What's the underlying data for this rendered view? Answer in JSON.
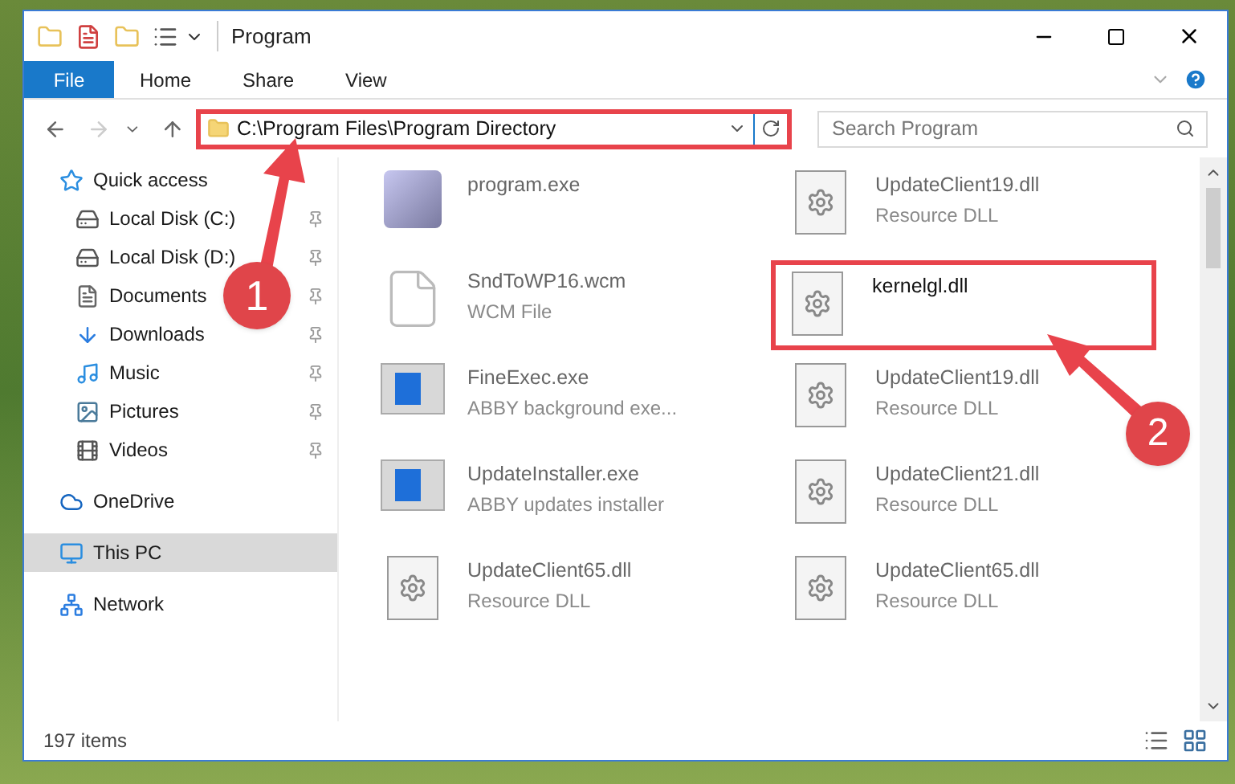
{
  "window": {
    "title": "Program"
  },
  "ribbon_tabs": [
    {
      "label": "File",
      "selected": true
    },
    {
      "label": "Home",
      "selected": false
    },
    {
      "label": "Share",
      "selected": false
    },
    {
      "label": "View",
      "selected": false
    }
  ],
  "address_bar": {
    "path": "C:\\Program Files\\Program Directory",
    "highlighted": true
  },
  "search": {
    "placeholder": "Search Program"
  },
  "sidebar": {
    "items": [
      {
        "label": "Quick access",
        "selected": false,
        "children": [
          {
            "label": "Local Disk (C:)",
            "pinned": true
          },
          {
            "label": "Local Disk (D:)",
            "pinned": true
          },
          {
            "label": "Documents",
            "pinned": true
          },
          {
            "label": "Downloads",
            "pinned": true
          },
          {
            "label": "Music",
            "pinned": true
          },
          {
            "label": "Pictures",
            "pinned": true
          },
          {
            "label": "Videos",
            "pinned": true
          }
        ]
      },
      {
        "label": "OneDrive",
        "selected": false
      },
      {
        "label": "This PC",
        "selected": true
      },
      {
        "label": "Network",
        "selected": false
      }
    ]
  },
  "files": [
    {
      "name": "program.exe",
      "kind": "exe",
      "highlighted": false
    },
    {
      "name": "UpdateClient19.dll",
      "type": "Resource DLL",
      "kind": "dll",
      "highlighted": false
    },
    {
      "name": "SndToWP16.wcm",
      "type": "WCM File",
      "kind": "blank",
      "highlighted": false
    },
    {
      "name": "kernelgl.dll",
      "kind": "dll",
      "highlighted": true
    },
    {
      "name": "FineExec.exe",
      "type": "ABBY background exe...",
      "kind": "app",
      "highlighted": false
    },
    {
      "name": "UpdateClient19.dll",
      "type": "Resource DLL",
      "kind": "dll",
      "highlighted": false
    },
    {
      "name": "UpdateInstaller.exe",
      "type": "ABBY updates installer",
      "kind": "app",
      "highlighted": false
    },
    {
      "name": "UpdateClient21.dll",
      "type": "Resource DLL",
      "kind": "dll",
      "highlighted": false
    },
    {
      "name": "UpdateClient65.dll",
      "type": "Resource DLL",
      "kind": "dll",
      "highlighted": false
    },
    {
      "name": "UpdateClient65.dll",
      "type": "Resource DLL",
      "kind": "dll",
      "highlighted": false
    }
  ],
  "callouts": [
    {
      "number": "1"
    },
    {
      "number": "2"
    }
  ],
  "status_bar": {
    "count": "197 items"
  }
}
